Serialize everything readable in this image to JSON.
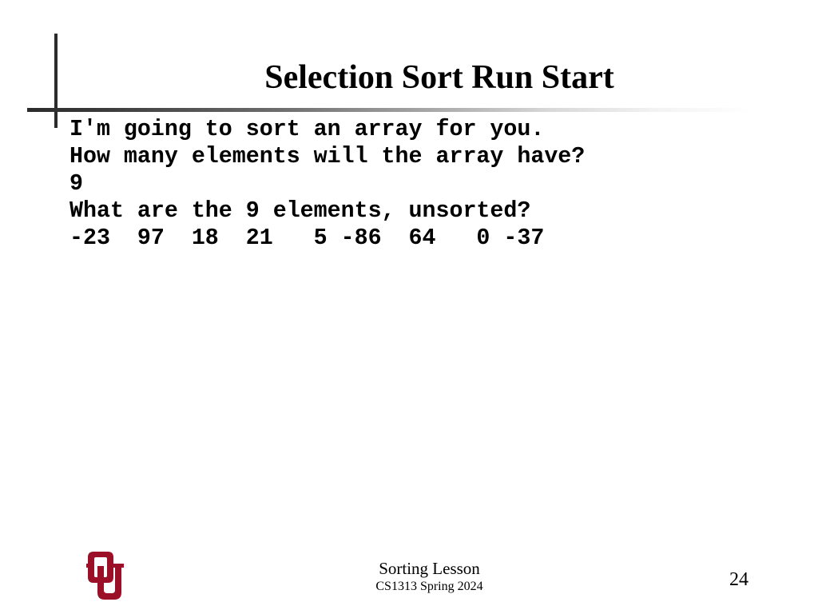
{
  "slide": {
    "title": "Selection Sort Run Start",
    "console_output": [
      "I'm going to sort an array for you.",
      "How many elements will the array have?",
      "9",
      "What are the 9 elements, unsorted?",
      "-23  97  18  21   5 -86  64   0 -37"
    ]
  },
  "footer": {
    "lesson": "Sorting Lesson",
    "course": "CS1313 Spring 2024",
    "page_number": "24",
    "logo": {
      "icon": "ou-logo-icon",
      "color": "#9b1027"
    }
  },
  "colors": {
    "text": "#000000",
    "rule": "#2b2b2b",
    "background": "#ffffff"
  }
}
